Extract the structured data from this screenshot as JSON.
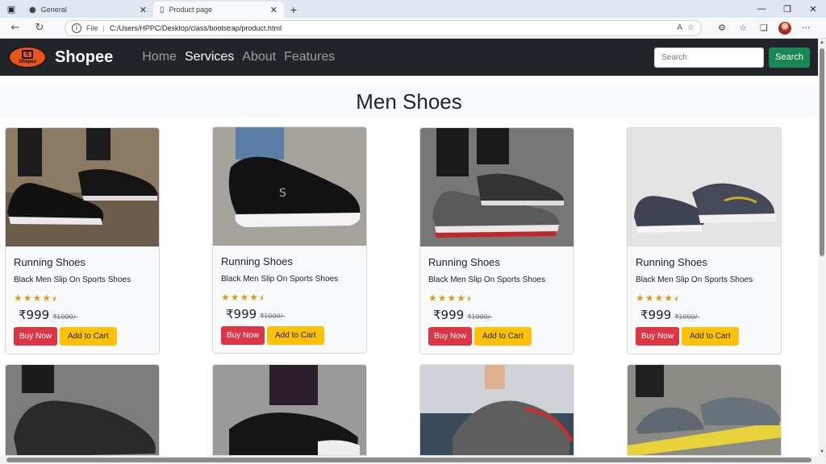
{
  "browser": {
    "tabs": [
      {
        "title": "General",
        "icon": "github-icon"
      },
      {
        "title": "Product page",
        "icon": "page-icon"
      }
    ],
    "file_label": "File",
    "url": "C:/Users/HPPC/Desktop/class/bootstrap/product.html"
  },
  "navbar": {
    "logo_text": "Shopee",
    "brand": "Shopee",
    "links": [
      "Home",
      "Services",
      "About",
      "Features"
    ],
    "active_link": "Services",
    "search_placeholder": "Search",
    "search_button": "Search"
  },
  "page": {
    "heading": "Men Shoes"
  },
  "products": [
    {
      "title": "Running Shoes",
      "desc": "Black Men Slip On Sports Shoes",
      "rating": 4.5,
      "price": "₹999",
      "old_price": "₹1000/-",
      "buy": "Buy Now",
      "cart": "Add to Cart"
    },
    {
      "title": "Running Shoes",
      "desc": "Black Men Slip On Sports Shoes",
      "rating": 4.5,
      "price": "₹999",
      "old_price": "₹1000/-",
      "buy": "Buy Now",
      "cart": "Add to Cart"
    },
    {
      "title": "Running Shoes",
      "desc": "Black Men Slip On Sports Shoes",
      "rating": 4.5,
      "price": "₹999",
      "old_price": "₹1000/-",
      "buy": "Buy Now",
      "cart": "Add to Cart"
    },
    {
      "title": "Running Shoes",
      "desc": "Black Men Slip On Sports Shoes",
      "rating": 4.5,
      "price": "₹999",
      "old_price": "₹1000/-",
      "buy": "Buy Now",
      "cart": "Add to Cart"
    }
  ],
  "colors": {
    "navbar_bg": "#212529",
    "search_button": "#198754",
    "buy_button": "#dc3545",
    "cart_button": "#ffc107",
    "star": "#d4a017"
  }
}
